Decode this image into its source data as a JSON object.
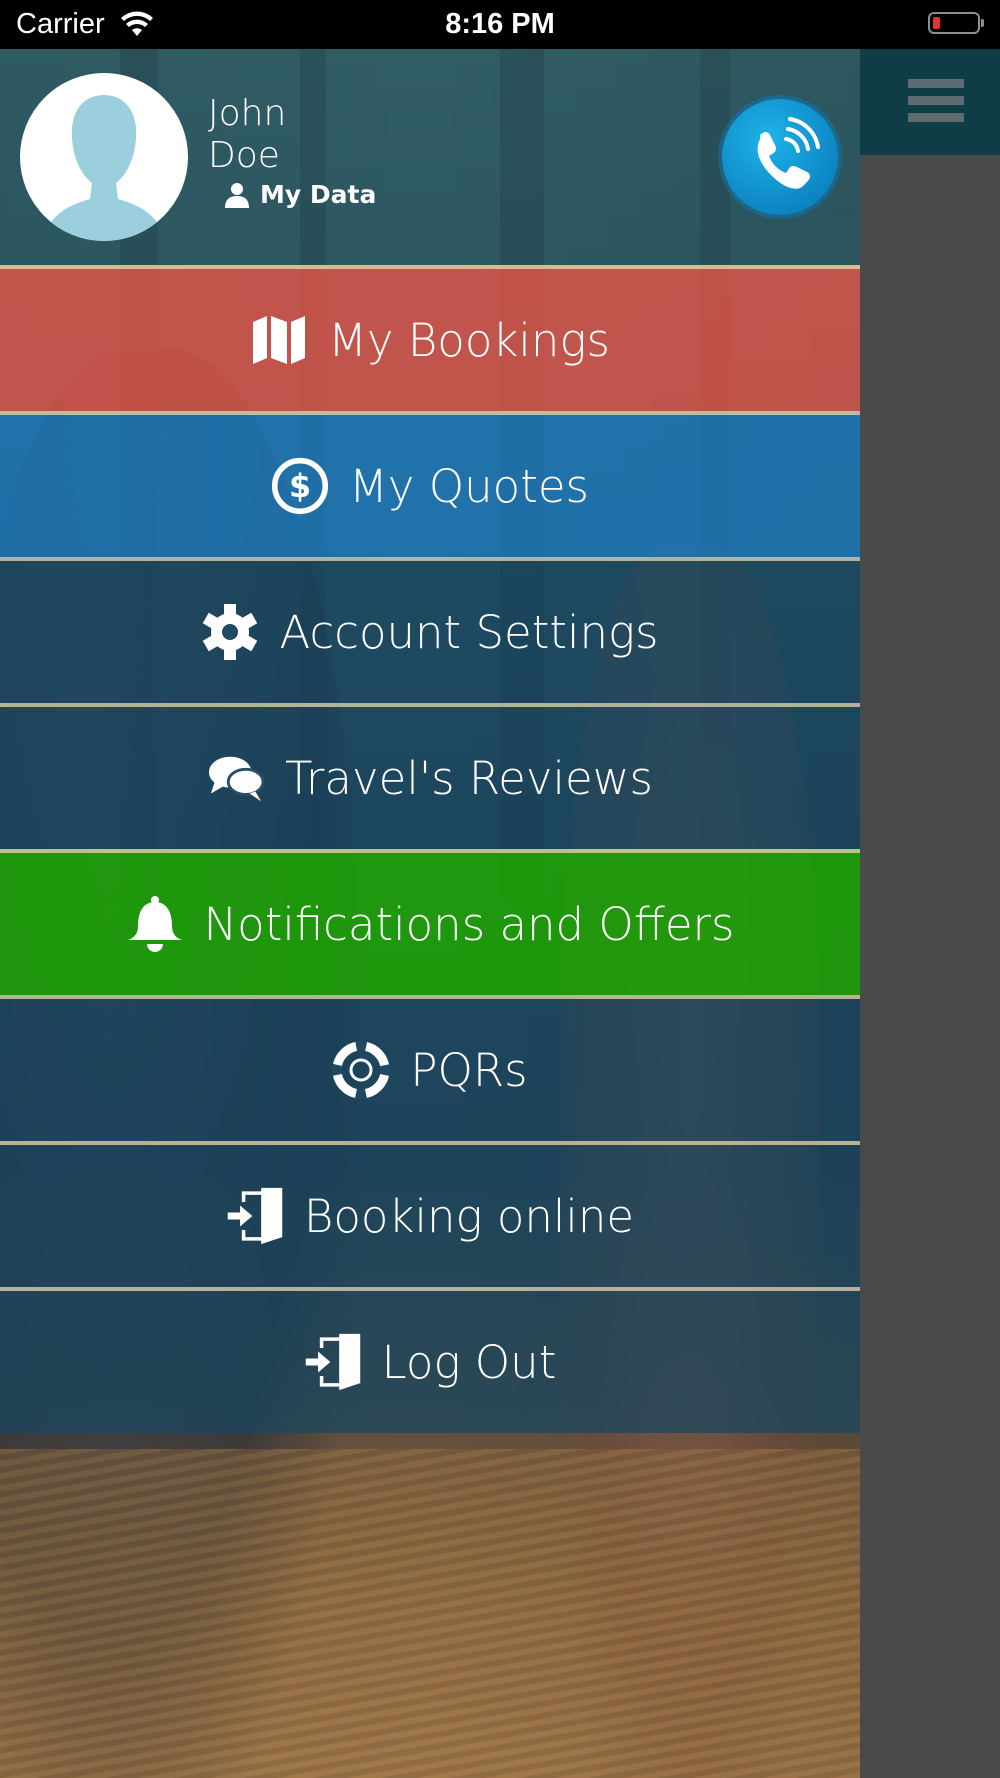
{
  "status_bar": {
    "carrier": "Carrier",
    "time": "8:16 PM"
  },
  "user": {
    "first_name": "John",
    "last_name": "Doe",
    "my_data_label": "My Data"
  },
  "menu": [
    {
      "label": "My Bookings",
      "icon": "map-icon",
      "color": "#db5448"
    },
    {
      "label": "My Quotes",
      "icon": "dollar-circle-icon",
      "color": "#1f78ba"
    },
    {
      "label": "Account Settings",
      "icon": "gear-icon",
      "color": "#19465f"
    },
    {
      "label": "Travel's Reviews",
      "icon": "chat-bubbles-icon",
      "color": "#19465f"
    },
    {
      "label": "Notifications and Offers",
      "icon": "bell-icon",
      "color": "#1e9e08"
    },
    {
      "label": "PQRs",
      "icon": "life-ring-icon",
      "color": "#19465f"
    },
    {
      "label": "Booking online",
      "icon": "sign-in-icon",
      "color": "#19465f"
    },
    {
      "label": "Log Out",
      "icon": "sign-in-icon",
      "color": "#19465f"
    }
  ],
  "icons": {
    "call": "phone-call-icon",
    "menu": "hamburger-menu-icon"
  }
}
